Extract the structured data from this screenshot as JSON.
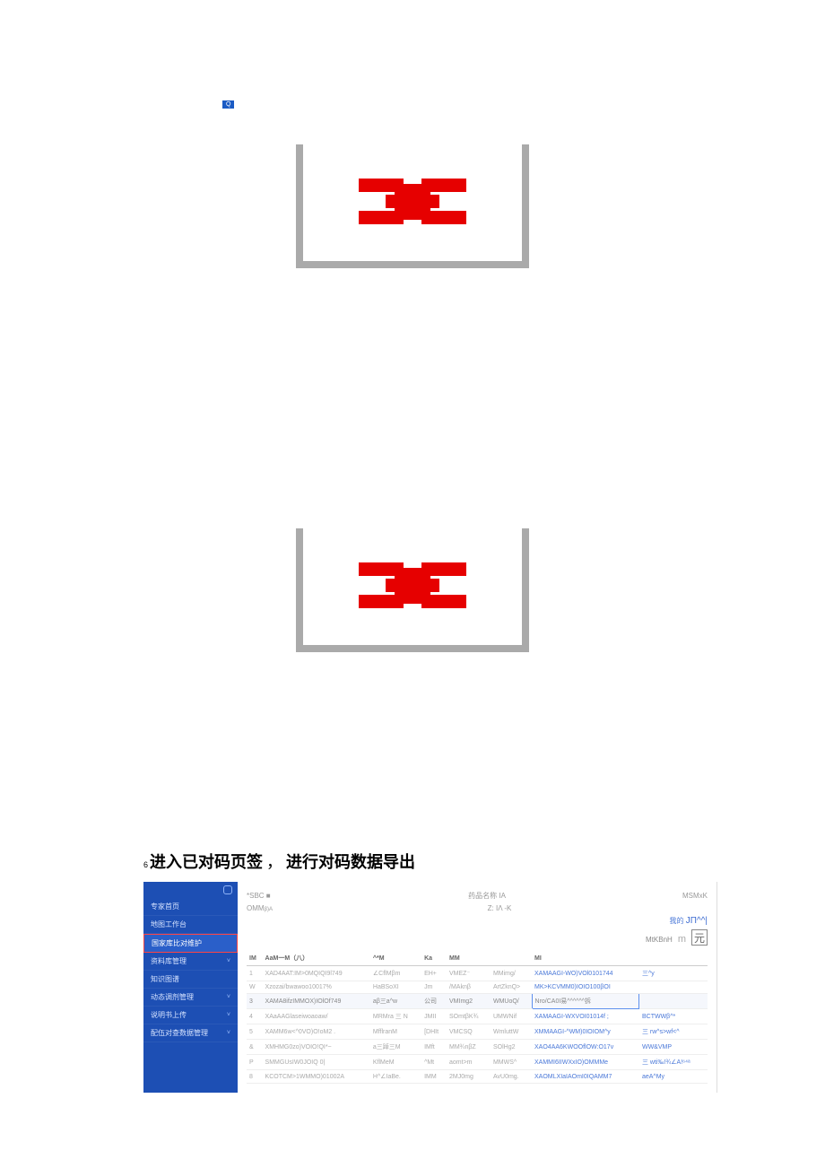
{
  "top_badge": "Q",
  "heading": {
    "num": "6",
    "text_a": "进入已对码页签",
    "sep": "，",
    "text_b": "进行对码数据导出"
  },
  "sidebar": {
    "items": [
      {
        "label": "专家首页",
        "chev": false,
        "active": false
      },
      {
        "label": "地图工作台",
        "chev": false,
        "active": false
      },
      {
        "label": "国家库比对维护",
        "chev": false,
        "active": true
      },
      {
        "label": "资料库管理",
        "chev": true,
        "active": false
      },
      {
        "label": "知识图谱",
        "chev": false,
        "active": false
      },
      {
        "label": "动态调剂管理",
        "chev": true,
        "active": false
      },
      {
        "label": "说明书上传",
        "chev": true,
        "active": false
      },
      {
        "label": "配伍对查数据管理",
        "chev": true,
        "active": false
      }
    ]
  },
  "filters": {
    "row1_a_label": "*SBC",
    "row1_a_symbol": "■",
    "row1_mid_label": "药品名称",
    "row1_mid_symbol": "IA",
    "row1_right_label": "MSMxK",
    "row2_a_label": "OMM",
    "row2_a_sub": "β)A",
    "row2_mid_label": "Z: IΛ -K"
  },
  "right_meta": {
    "prefix": "我的",
    "sym_text": "JΠ^^|"
  },
  "stat": {
    "label": "MtKBnH",
    "m": "m",
    "box": "元"
  },
  "columns": [
    "IM",
    "AaM一M（八）",
    "^*M",
    "Ka",
    "MM",
    "",
    "MI",
    ""
  ],
  "rows": [
    {
      "c0": "1",
      "c1": "XAD4AAT:IM>0MQIQI9l749",
      "c2": "∠CflMβm",
      "c3": "EH+",
      "c4": "VMEZ⁻",
      "c5": "MMimg/",
      "c6": "XAMAAGI-WO)VOl0101744",
      "c7": "三^y"
    },
    {
      "c0": "W",
      "c1": "Xzozai/bwawoo10017%",
      "c2": "HaBSoXI",
      "c3": "Jm",
      "c4": "/MAknβ",
      "c5": "ArtZknQ>",
      "c6": "MK>KCVMM0)IOIO100βOI",
      "c7": ""
    },
    {
      "c0": "3",
      "c1": "XAMA8ifzIMMOX)IOlOf749",
      "c2": "aβ三a^w",
      "c3": "公司",
      "c4": "VMImg2",
      "c5": "WMUoQ/",
      "c6": "Nro/CA0I易^^^^^^拆",
      "c7": "",
      "hl": true
    },
    {
      "c0": "4",
      "c1": "XAaAAGlaseiwoaoaw/",
      "c2": "MRMra 三 N",
      "c3": "JMII",
      "c4": "SOmtβK¾",
      "c5": "UMWNif",
      "c6": "XAMAAGI-WXVOI01014f ;",
      "c7": "BCTWWβ^*"
    },
    {
      "c0": "5",
      "c1": "XAMM6w<^0VO)O!oM2 .",
      "c2": "MfflranM",
      "c3": "[DHIt",
      "c4": "VMCSQ",
      "c5": "WmluttW",
      "c6": "XMMAAGI-^WM)0IOIOM^y",
      "c7": "三 rw^s>wf<^"
    },
    {
      "c0": "&",
      "c1": "XMHMG0zo)VOIO!QI*~",
      "c2": "a三踔三M",
      "c3": "IMft",
      "c4": "MM¾nβZ",
      "c5": "SOlHg2",
      "c6": "XAO4AA6KWOOflOW:O17v",
      "c7": "WW&VMP"
    },
    {
      "c0": "P",
      "c1": "SMMGUsIW0JOIQ  0|",
      "c2": "KflMeM",
      "c3": "^Mt",
      "c4": "aomt>m",
      "c5": "MMWS^",
      "c6": "XAMMI6IIWXxIO)OMMMe",
      "c7": "三 wti‰!¾∠A!⁶⁴ᵃ"
    },
    {
      "c0": "8",
      "c1": "KCOTCM>1WMMO)01002A",
      "c2": "H^∠IaBe.",
      "c3": "IMM",
      "c4": "2MJ0mg",
      "c5": "AvU0mg.",
      "c6": "XAOMLXIaIAOmI0IQAMM7",
      "c7": "aeA^My"
    }
  ]
}
